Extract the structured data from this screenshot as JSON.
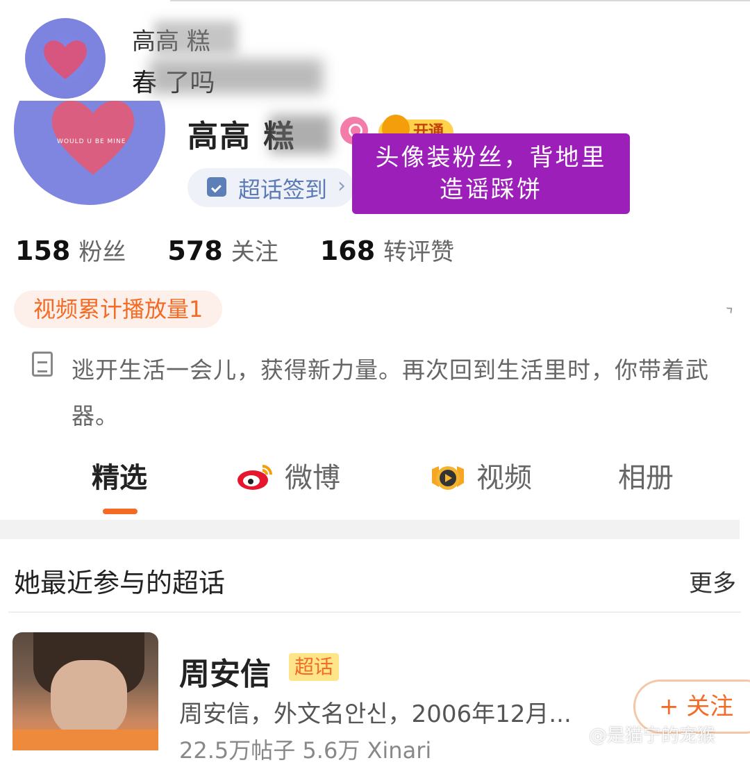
{
  "comment": {
    "user_name": "高高 糕",
    "text": "春    了吗"
  },
  "profile": {
    "name": "高高 糕",
    "vip_label": "开通",
    "checkin_label": "超话签到",
    "checkin_arrow": "›",
    "overlay_caption_line1": "头像装粉丝，背地里",
    "overlay_caption_line2": "造谣踩饼",
    "avatar_text": "WOULD U BE MINE",
    "stats": [
      {
        "value": "158",
        "label": "粉丝"
      },
      {
        "value": "578",
        "label": "关注"
      },
      {
        "value": "168",
        "label": "转评赞"
      }
    ],
    "video_pill": "视频累计播放量1",
    "bio": "逃开生活一会儿，获得新力量。再次回到生活里时，你带着武器。"
  },
  "tabs": [
    {
      "label": "精选",
      "active": true
    },
    {
      "label": "微博"
    },
    {
      "label": "视频"
    },
    {
      "label": "相册"
    }
  ],
  "section": {
    "title": "她最近参与的超话",
    "more": "更多"
  },
  "topic": {
    "name": "周安信",
    "tag": "超话",
    "description": "周安信，外文名안신，2006年12月...",
    "stats": "22.5万帖子 5.6万 Xinari",
    "follow_label": "+ 关注"
  },
  "watermark": "@是猫宁的宠猴",
  "colors": {
    "accent_orange": "#f36b25",
    "overlay_purple": "#9b1fb8",
    "checkin_blue": "#5a7bb5",
    "avatar_blue": "#7f86e0"
  }
}
